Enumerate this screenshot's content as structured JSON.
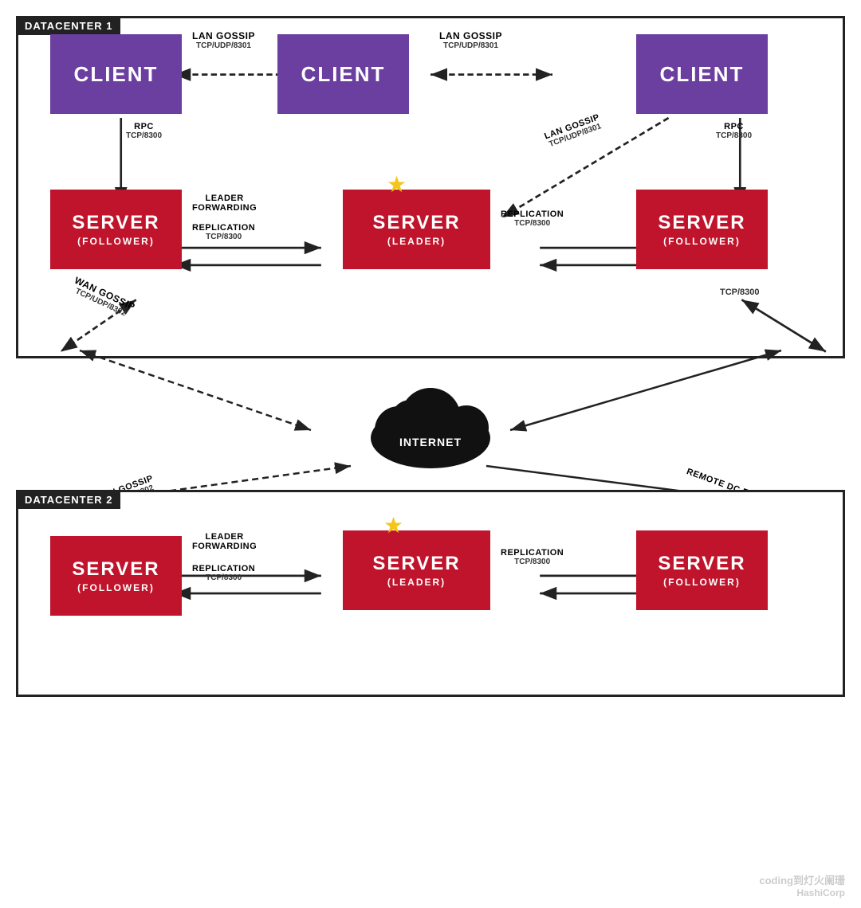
{
  "dc1": {
    "label": "DATACENTER 1",
    "clients": [
      "CLIENT",
      "CLIENT",
      "CLIENT"
    ],
    "servers": [
      {
        "title": "SERVER",
        "sub": "(FOLLOWER)"
      },
      {
        "title": "SERVER",
        "sub": "(LEADER)"
      },
      {
        "title": "SERVER",
        "sub": "(FOLLOWER)"
      }
    ]
  },
  "dc2": {
    "label": "DATACENTER 2",
    "servers": [
      {
        "title": "SERVER",
        "sub": "(FOLLOWER)"
      },
      {
        "title": "SERVER",
        "sub": "(LEADER)"
      },
      {
        "title": "SERVER",
        "sub": "(FOLLOWER)"
      }
    ]
  },
  "internet": {
    "label": "INTERNET"
  },
  "connections": {
    "lan_gossip": "LAN GOSSIP",
    "lan_gossip_port": "TCP/UDP/8301",
    "rpc": "RPC",
    "rpc_port": "TCP/8300",
    "leader_forwarding": "LEADER\nFORWARDING",
    "replication": "REPLICATION",
    "replication_port": "TCP/8300",
    "wan_gossip": "WAN GOSSIP",
    "wan_gossip_port": "TCP/UDP/8302",
    "remote_dc_forwarding": "REMOTE DC FORWARDING",
    "tcp8300": "TCP/8300"
  },
  "watermark": {
    "line1": "coding到灯火阑珊",
    "line2": "HashiCorp"
  }
}
